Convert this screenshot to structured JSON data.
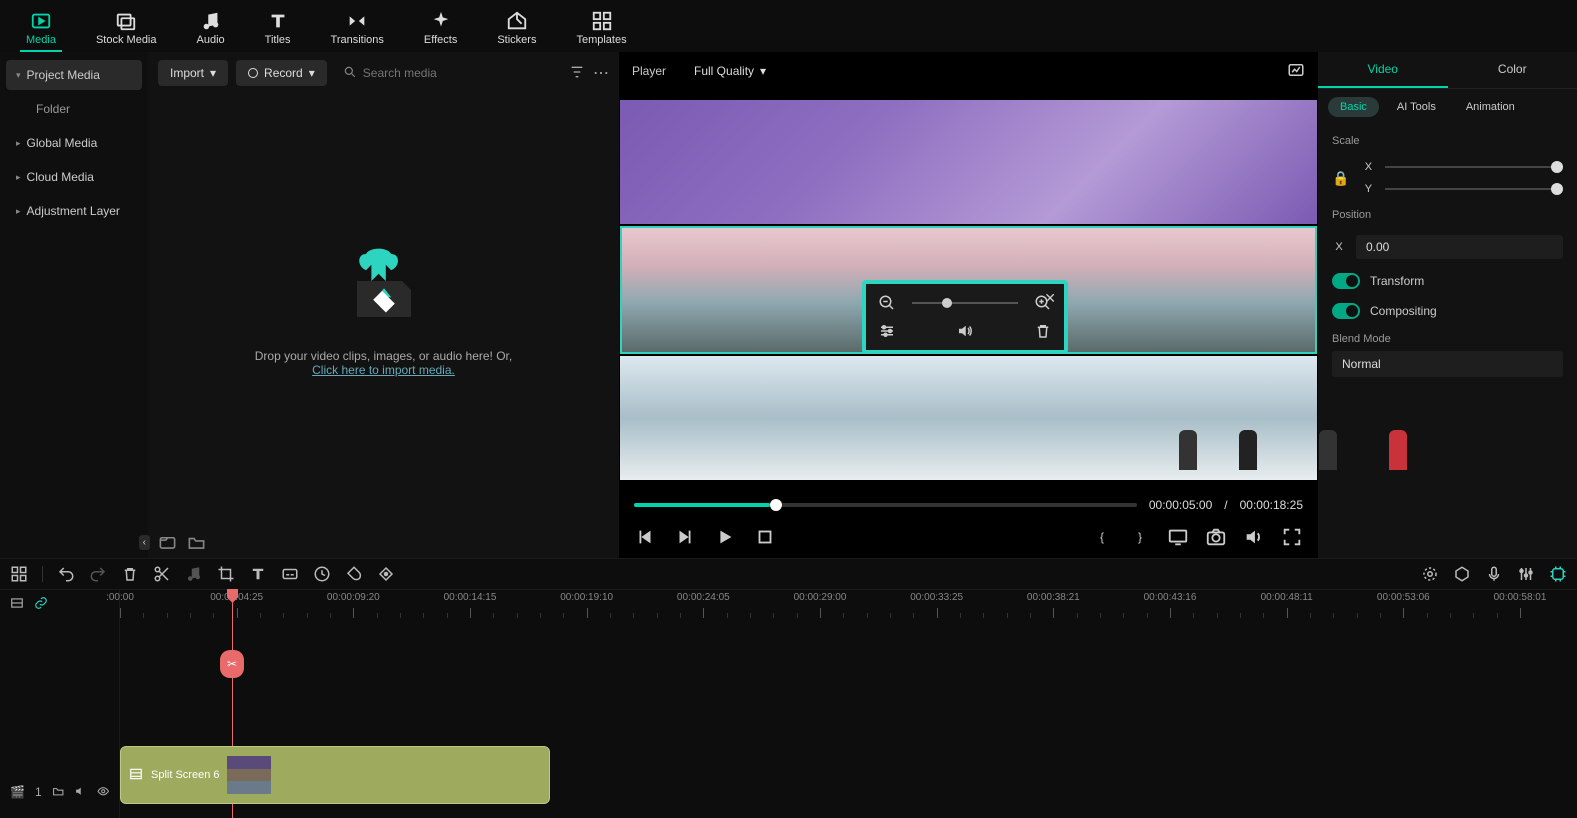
{
  "topnav": {
    "items": [
      {
        "label": "Media"
      },
      {
        "label": "Stock Media"
      },
      {
        "label": "Audio"
      },
      {
        "label": "Titles"
      },
      {
        "label": "Transitions"
      },
      {
        "label": "Effects"
      },
      {
        "label": "Stickers"
      },
      {
        "label": "Templates"
      }
    ]
  },
  "media_sidebar": {
    "project_media": "Project Media",
    "folder": "Folder",
    "global_media": "Global Media",
    "cloud_media": "Cloud Media",
    "adjustment_layer": "Adjustment Layer"
  },
  "media_toolbar": {
    "import": "Import",
    "record": "Record",
    "search_placeholder": "Search media"
  },
  "drop": {
    "line1": "Drop your video clips, images, or audio here! Or,",
    "link": "Click here to import media."
  },
  "player": {
    "header_label": "Player",
    "quality": "Full Quality",
    "current_time": "00:00:05:00",
    "sep": "/",
    "duration": "00:00:18:25"
  },
  "inspector": {
    "tabs": {
      "video": "Video",
      "color": "Color"
    },
    "subtabs": {
      "basic": "Basic",
      "aitools": "AI Tools",
      "animation": "Animation"
    },
    "scale_label": "Scale",
    "scale_x": "X",
    "scale_y": "Y",
    "position_label": "Position",
    "pos_x_label": "X",
    "pos_x_value": "0.00",
    "transform_label": "Transform",
    "compositing_label": "Compositing",
    "blend_label": "Blend Mode",
    "blend_value": "Normal"
  },
  "timeline": {
    "ruler": [
      ":00:00",
      "00:00:04:25",
      "00:00:09:20",
      "00:00:14:15",
      "00:00:19:10",
      "00:00:24:05",
      "00:00:29:00",
      "00:00:33:25",
      "00:00:38:21",
      "00:00:43:16",
      "00:00:48:11",
      "00:00:53:06",
      "00:00:58:01"
    ],
    "clip_label": "Split Screen 6",
    "track_badge": "1"
  }
}
